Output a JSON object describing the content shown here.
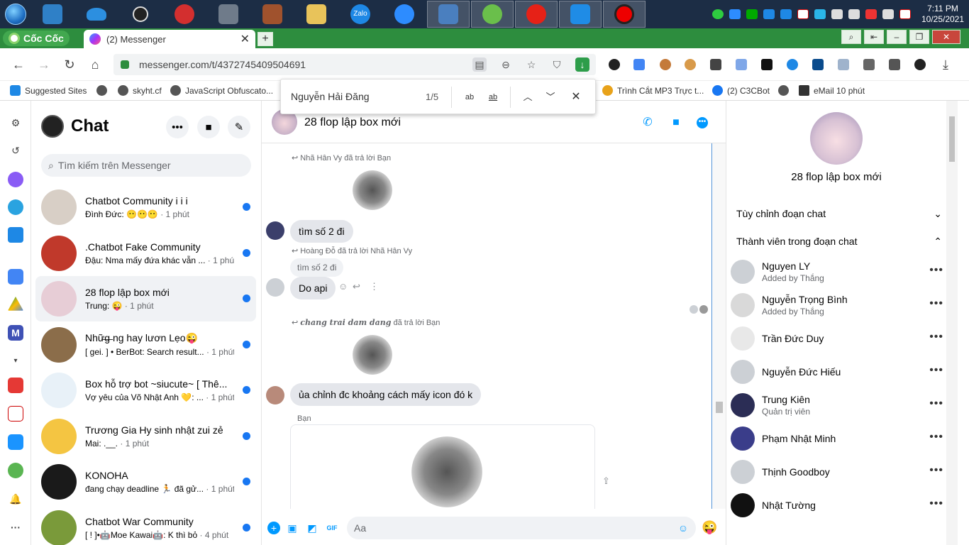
{
  "taskbar": {
    "clock_time": "7:11 PM",
    "clock_date": "10/25/2021",
    "apps": [
      "vscode",
      "onedrive",
      "obs",
      "garena",
      "anonymous",
      "game",
      "explorer",
      "zalo",
      "zoom",
      "remote",
      "coccoc",
      "youtube",
      "remote-desktop",
      "recorder"
    ],
    "zalo_label": "Zalo"
  },
  "browser": {
    "brand": "Cốc Cốc",
    "tab_title": "(2) Messenger",
    "url": "messenger.com/t/4372745409504691",
    "bookmarks": [
      "Suggested Sites",
      "skyht.cf",
      "JavaScript Obfuscato...",
      "Trình Cắt MP3 Trực t...",
      "(2) C3CBot",
      "eMail 10 phút"
    ]
  },
  "find": {
    "query": "Nguyễn Hải Đăng",
    "count": "1/5",
    "case_label": "ab",
    "word_label": "ab"
  },
  "sidebar": {
    "title": "Chat",
    "search_placeholder": "Tìm kiếm trên Messenger",
    "chats": [
      {
        "name": "Chatbot Community i i i",
        "preview": "Đình Đức: 😶😶😶",
        "time": " · 1 phút",
        "color": "#d8cfc6"
      },
      {
        "name": ".Chatbot Fake Community",
        "preview": "Đậu: Nma mấy đứa khác vẫn ...",
        "time": " · 1 phút",
        "color": "#c0392b"
      },
      {
        "name": "28 flop lập box mới",
        "preview": "Trung: 😜",
        "time": " · 1 phút",
        "color": "#e7cdd6"
      },
      {
        "name": "Nhữ̶g̶ ng hay lươn Lẹo😜",
        "preview": "[ gei. ] • BerBot: Search result...",
        "time": " · 1 phút",
        "color": "#8b6d4a"
      },
      {
        "name": "Box hỗ trợ bot ~siucute~ [ Thê...",
        "preview": "Vợ yêu của Võ Nhật Anh 💛: ...",
        "time": " · 1 phút",
        "color": "#e8f1f8"
      },
      {
        "name": "Trương Gia Hy sinh nhật zui zẻ",
        "preview": "Mai: .__.",
        "time": " · 1 phút",
        "color": "#f4c542"
      },
      {
        "name": "KONOHA",
        "preview": "đang chạy deadline 🏃 đã gử...",
        "time": " · 1 phút",
        "color": "#1a1a1a"
      },
      {
        "name": "Chatbot War Community",
        "preview": "[ ! ]•🤖Moe Kawai🤖: K thì bỏ",
        "time": " · 4 phút",
        "color": "#7a9a3a"
      }
    ]
  },
  "conversation": {
    "title": "28 flop lập box mới",
    "reply1": "Nhã Hân Vy đã trả lời Bạn",
    "msg1": "tìm số 2 đi",
    "reply2": "Hoàng Đỗ đã trả lời Nhã Hân Vy",
    "quoted2": "tìm số 2 đi",
    "msg2": "Do api",
    "reply3_author": "chang trai dam dang",
    "reply3_rest": " đã trả lời Bạn",
    "msg3": "ủa chỉnh đc khoảng cách mấy icon đó k",
    "you_label": "Bạn",
    "composer_placeholder": "Aa",
    "composer_emoji": "😜"
  },
  "info": {
    "group_name": "28 flop lập box mới",
    "section_customize": "Tùy chỉnh đoạn chat",
    "section_members": "Thành viên trong đoạn chat",
    "members": [
      {
        "name": "Nguyen LY",
        "sub": "Added by Thắng"
      },
      {
        "name": "Nguyễn Trọng Bình",
        "sub": "Added by Thắng"
      },
      {
        "name": "Trần Đức Duy",
        "sub": ""
      },
      {
        "name": "Nguyễn Đức Hiếu",
        "sub": ""
      },
      {
        "name": "Trung Kiên",
        "sub": "Quản trị viên"
      },
      {
        "name": "Phạm Nhật Minh",
        "sub": ""
      },
      {
        "name": "Thịnh Goodboy",
        "sub": ""
      },
      {
        "name": "Nhật Tường",
        "sub": ""
      }
    ]
  },
  "colors": {
    "accent": "#0099ff",
    "unread": "#1877f2",
    "browser_green": "#2d8d3e"
  }
}
